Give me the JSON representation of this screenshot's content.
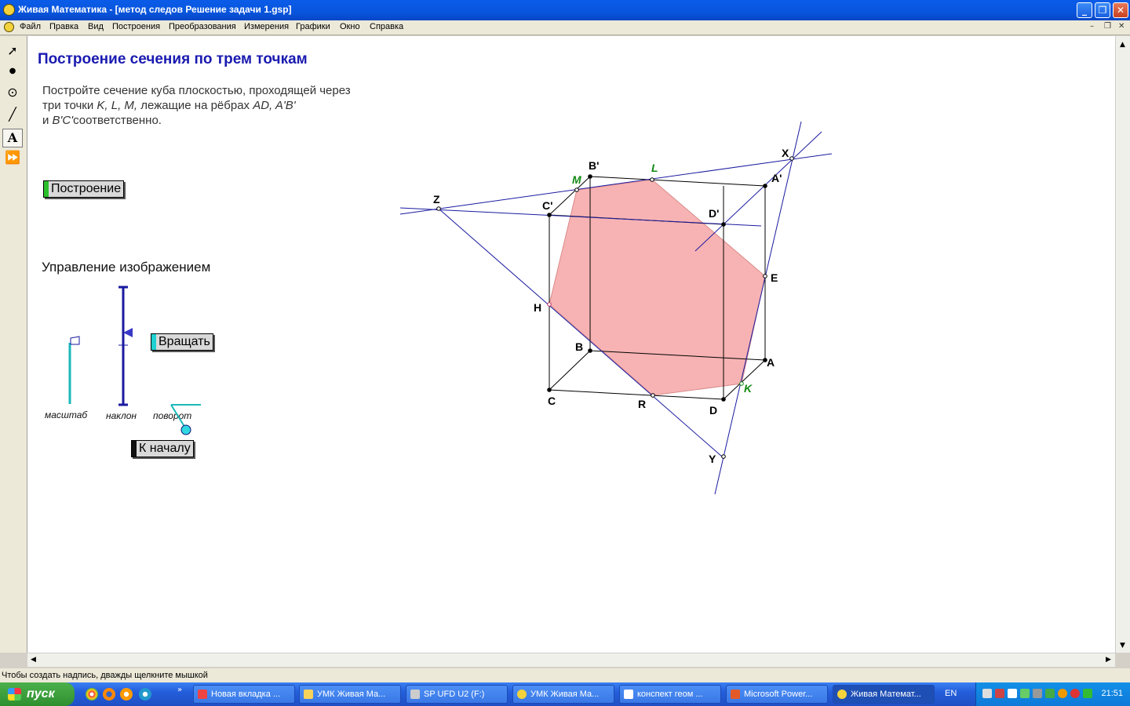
{
  "window": {
    "title": "Живая Математика - [метод следов Решение задачи 1.gsp]",
    "controls": [
      "_",
      "❐",
      "✕"
    ]
  },
  "menu": [
    "Файл",
    "Правка",
    "Вид",
    "Построения",
    "Преобразования",
    "Измерения",
    "Графики",
    "Окно",
    "Справка"
  ],
  "toolbox": [
    "arrow-tool",
    "point-tool",
    "compass-tool",
    "line-tool",
    "text-tool",
    "custom-tool"
  ],
  "page": {
    "title": "Построение сечения по трем точкам",
    "instruction_parts": {
      "a": "Постройте сечение куба плоскостью, проходящей через три точки ",
      "b": "K, L, M,",
      "c": " лежащие на рёбрах ",
      "d": "AD, A'B'",
      "e": " и ",
      "f": "B'C'",
      "g": "соответственно."
    },
    "build_button": "Построение",
    "control_title": "Управление изображением",
    "rotate_button": "Вращать",
    "reset_button": "К началу",
    "slider_labels": {
      "scale": "масштаб",
      "tilt": "наклон",
      "rotation": "поворот"
    }
  },
  "figure": {
    "points": {
      "B'": "B'",
      "L": "L",
      "M": "M",
      "X": "X",
      "A'": "A'",
      "Z": "Z",
      "C'": "C'",
      "D'": "D'",
      "E": "E",
      "H": "H",
      "B": "B",
      "A": "A",
      "K": "K",
      "C": "C",
      "R": "R",
      "D": "D",
      "Y": "Y"
    },
    "section_color": "#f7b3b3",
    "line_color": "#1a1aa0",
    "given_point_color": "#138a13"
  },
  "statusbar": "Чтобы создать надпись, дважды щелкните мышкой",
  "taskbar": {
    "start": "пуск",
    "tasks": [
      "Новая вкладка ...",
      "УМК Живая Ма...",
      "SP UFD U2 (F:)",
      "УМК Живая Ма...",
      "конспект геом ...",
      "Microsoft Power...",
      "Живая Математ..."
    ],
    "lang": "EN",
    "clock": "21:51"
  }
}
